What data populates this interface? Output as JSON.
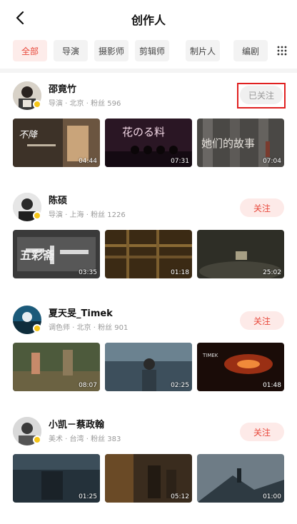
{
  "header": {
    "title": "创作人"
  },
  "tabs": [
    {
      "label": "全部",
      "active": true
    },
    {
      "label": "导演",
      "active": false
    },
    {
      "label": "摄影师",
      "active": false
    },
    {
      "label": "剪辑师",
      "active": false
    },
    {
      "label": "制片人",
      "active": false
    },
    {
      "label": "编剧",
      "active": false
    }
  ],
  "creators": [
    {
      "name": "邵竟竹",
      "meta": "导演 · 北京 · 粉丝 596",
      "follow_label": "已关注",
      "videos": [
        {
          "duration": "04:44",
          "overlay": "不降"
        },
        {
          "duration": "07:31",
          "overlay": "花のる料"
        },
        {
          "duration": "07:04",
          "overlay": "她们的故事"
        }
      ]
    },
    {
      "name": "陈硕",
      "meta": "导演 · 上海 · 粉丝 1226",
      "follow_label": "关注",
      "videos": [
        {
          "duration": "03:35",
          "overlay": "五彩斋"
        },
        {
          "duration": "01:18",
          "overlay": ""
        },
        {
          "duration": "25:02",
          "overlay": ""
        }
      ]
    },
    {
      "name": "夏天旻_Timek",
      "meta": "调色师 · 北京 · 粉丝 901",
      "follow_label": "关注",
      "videos": [
        {
          "duration": "08:07",
          "overlay": ""
        },
        {
          "duration": "02:25",
          "overlay": ""
        },
        {
          "duration": "01:48",
          "overlay": "TIMEK"
        }
      ]
    },
    {
      "name": "小凯－蔡政翰",
      "meta": "美术 · 台湾 · 粉丝 383",
      "follow_label": "关注",
      "videos": [
        {
          "duration": "01:25",
          "overlay": ""
        },
        {
          "duration": "05:12",
          "overlay": ""
        },
        {
          "duration": "01:00",
          "overlay": ""
        }
      ]
    }
  ],
  "colors": {
    "accent": "#e8483b",
    "accent_bg": "#fdeae8",
    "highlight_box": "#e02020"
  }
}
